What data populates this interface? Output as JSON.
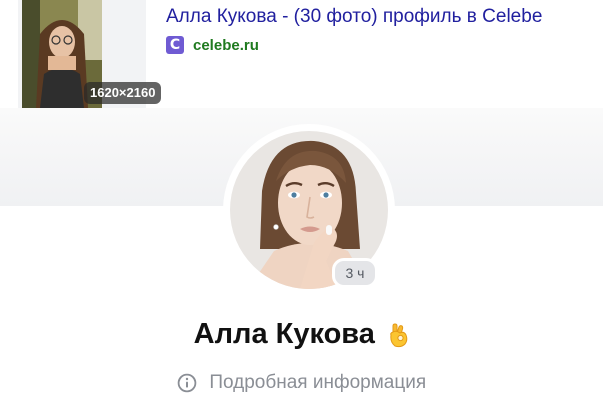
{
  "result": {
    "title": "Алла Кукова - (30 фото) профиль в Celebe",
    "image_size": "1620×2160",
    "favicon_letter": "C",
    "domain": "celebe.ru",
    "title_color": "#21209f",
    "domain_color": "#1f7a1f",
    "favicon_color": "#6f5bd3"
  },
  "profile": {
    "story_age": "3 ч",
    "name": "Алла Кукова",
    "name_emoji_icon": "ok-hand-icon",
    "details_icon": "info-circle-icon",
    "details_label": "Подробная информация"
  }
}
